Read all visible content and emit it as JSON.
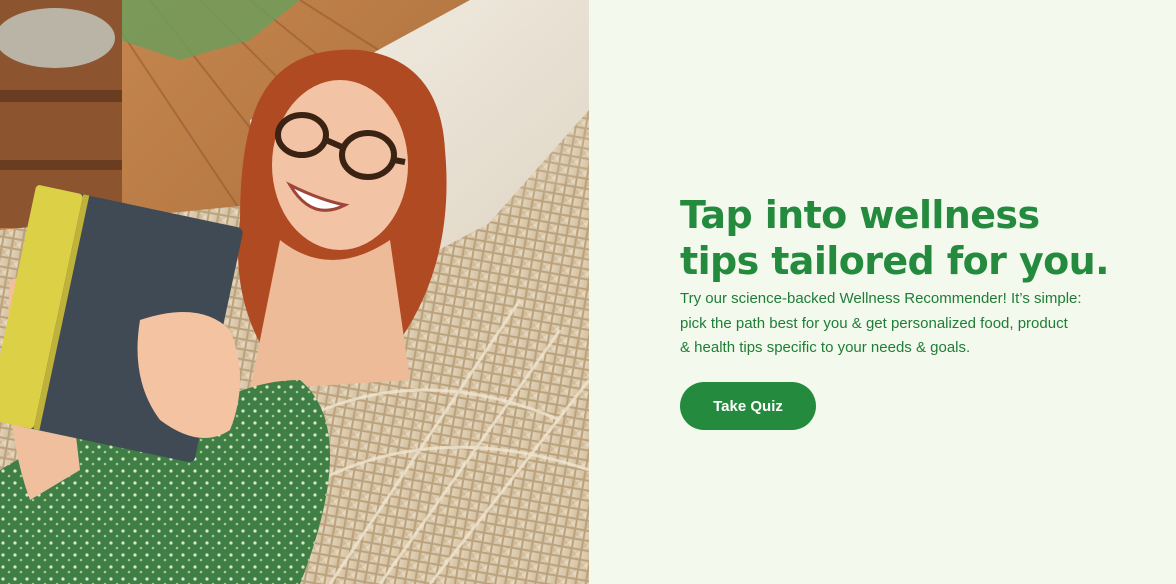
{
  "promo": {
    "image_alt": "Smiling woman with red hair and glasses reading a book while relaxing in a macrame hammock",
    "headline_line1": "Tap into wellness",
    "headline_line2": "tips tailored for you.",
    "body_line1": "Try our science-backed Wellness Recommender! It’s simple:",
    "body_line2": "pick the path best for you & get personalized food, product",
    "body_line3": "& health tips specific to your needs & goals.",
    "cta_label": "Take Quiz"
  },
  "colors": {
    "brand_green": "#248a3d",
    "panel_background": "#f3f9ed",
    "cta_text": "#ffffff"
  }
}
